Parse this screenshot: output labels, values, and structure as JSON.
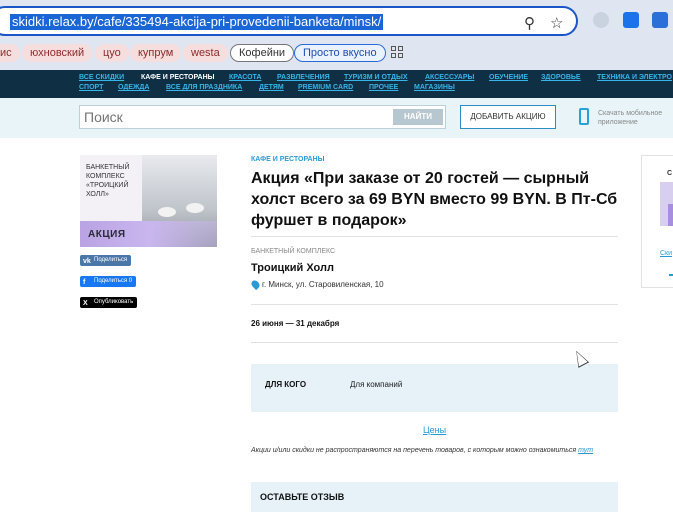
{
  "browser": {
    "url": "skidki.relax.by/cafe/335494-akcija-pri-provedenii-banketa/minsk/",
    "bookmarks": [
      "ис",
      "юхновский",
      "цуо",
      "купрум",
      "westa",
      "Кофейни",
      "Просто вкусно"
    ],
    "icons": [
      "zoom-icon",
      "star-icon",
      "shield-extension-icon",
      "download-icon",
      "s-extension-icon",
      "apps-icon"
    ]
  },
  "nav": {
    "row1": [
      "ВСЕ СКИДКИ",
      "КАФЕ И РЕСТОРАНЫ",
      "КРАСОТА",
      "РАЗВЛЕЧЕНИЯ",
      "ТУРИЗМ И ОТДЫХ",
      "АКСЕССУАРЫ",
      "ОБУЧЕНИЕ",
      "ЗДОРОВЬЕ",
      "ТЕХНИКА И ЭЛЕКТРО"
    ],
    "row2": [
      "СПОРТ",
      "ОДЕЖДА",
      "ВСЕ ДЛЯ ПРАЗДНИКА",
      "ДЕТЯМ",
      "PREMIUM CARD",
      "ПРОЧЕЕ",
      "МАГАЗИНЫ"
    ],
    "active": "КАФЕ И РЕСТОРАНЫ"
  },
  "search": {
    "placeholder": "Поиск",
    "button": "НАЙТИ",
    "add_promo": "ДОБАВИТЬ АКЦИЮ",
    "mobile_app": "Скачать мобильное приложение"
  },
  "promo_image": {
    "venue_text": "БАНКЕТНЫЙ КОМПЛЕКС «ТРОИЦКИЙ ХОЛЛ»",
    "badge": "АКЦИЯ"
  },
  "share": {
    "vk": "Поделиться",
    "fb": "Поделиться 0",
    "x": "Опубликовать"
  },
  "deal": {
    "category": "КАФЕ И РЕСТОРАНЫ",
    "title": "Акция «При заказе от 20 гостей — сырный холст всего за 69 BYN вместо 99 BYN. В Пт-Сб фуршет в подарок»",
    "venue_type": "БАНКЕТНЫЙ КОМПЛЕКС",
    "venue_name": "Троицкий Холл",
    "address": "г. Минск, ул. Старовиленская, 10",
    "dates": "26 июня — 31 декабря",
    "who_label": "ДЛЯ КОГО",
    "who_value": "Для компаний",
    "prices_link": "Цены",
    "disclaimer": "Акции и/или скидки не распространяются на перечень товаров, с которым можно ознакомиться",
    "disclaimer_link": "тут",
    "review_title": "ОСТАВЬТЕ ОТЗЫВ"
  },
  "sidebar": {
    "card_letter": "С",
    "card_link": "Ски"
  },
  "colors": {
    "nav_bg": "#0f2f45",
    "link_blue": "#2a9ad6",
    "light_band": "#e9f4f9",
    "promo_lilac": "#b9a3e3"
  }
}
